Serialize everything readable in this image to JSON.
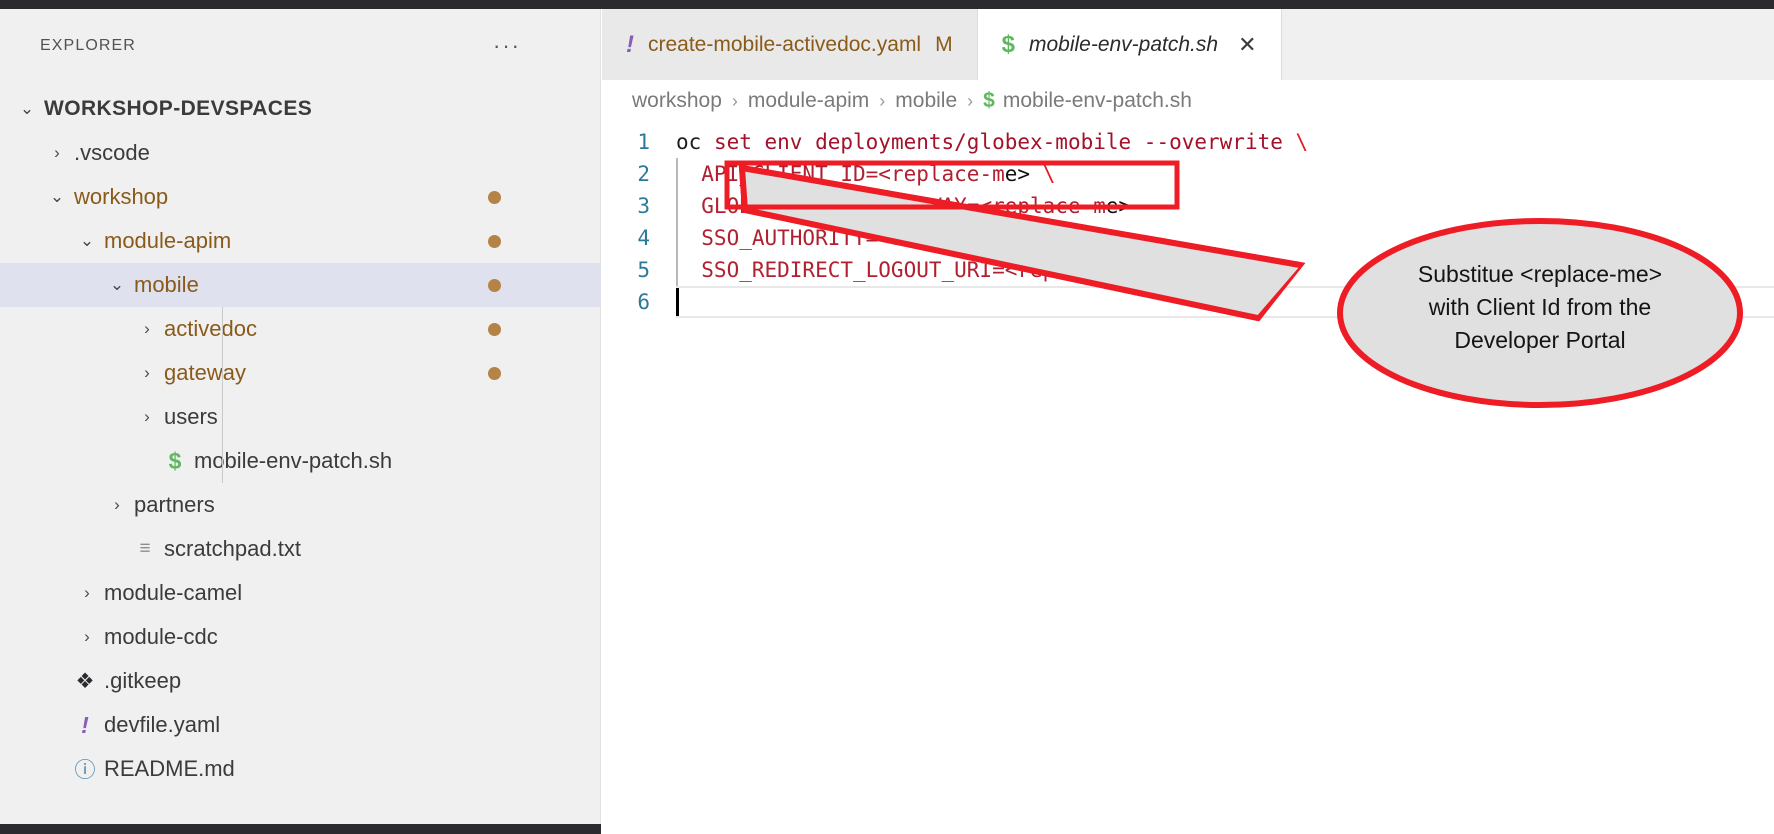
{
  "window": {
    "accent_modified": "#8a5a1b",
    "selection_bg": "#dfe1ef",
    "annotation_color": "#ee1c25",
    "balloon_fill": "#e0e0e0"
  },
  "sidebar": {
    "title": "EXPLORER",
    "more_actions": "···",
    "tree": [
      {
        "label": "WORKSHOP-DEVSPACES",
        "twisty": "⌄",
        "kind": "root",
        "depth": 0,
        "modified": false,
        "selected": false,
        "icon": ""
      },
      {
        "label": ".vscode",
        "twisty": "›",
        "kind": "folder",
        "depth": 1,
        "modified": false,
        "selected": false,
        "icon": ""
      },
      {
        "label": "workshop",
        "twisty": "⌄",
        "kind": "folder-mod",
        "depth": 1,
        "modified": true,
        "selected": false,
        "icon": ""
      },
      {
        "label": "module-apim",
        "twisty": "⌄",
        "kind": "folder-mod",
        "depth": 2,
        "modified": true,
        "selected": false,
        "icon": ""
      },
      {
        "label": "mobile",
        "twisty": "⌄",
        "kind": "folder-mod",
        "depth": 3,
        "modified": true,
        "selected": true,
        "icon": ""
      },
      {
        "label": "activedoc",
        "twisty": "›",
        "kind": "folder-mod",
        "depth": 4,
        "modified": true,
        "selected": false,
        "icon": ""
      },
      {
        "label": "gateway",
        "twisty": "›",
        "kind": "folder-mod",
        "depth": 4,
        "modified": true,
        "selected": false,
        "icon": ""
      },
      {
        "label": "users",
        "twisty": "›",
        "kind": "folder",
        "depth": 4,
        "modified": false,
        "selected": false,
        "icon": ""
      },
      {
        "label": "mobile-env-patch.sh",
        "twisty": "",
        "kind": "file",
        "depth": 4,
        "modified": false,
        "selected": false,
        "icon": "sh-file-icon"
      },
      {
        "label": "partners",
        "twisty": "›",
        "kind": "folder",
        "depth": 3,
        "modified": false,
        "selected": false,
        "icon": ""
      },
      {
        "label": "scratchpad.txt",
        "twisty": "",
        "kind": "file",
        "depth": 3,
        "modified": false,
        "selected": false,
        "icon": "txt-file-icon"
      },
      {
        "label": "module-camel",
        "twisty": "›",
        "kind": "folder",
        "depth": 2,
        "modified": false,
        "selected": false,
        "icon": ""
      },
      {
        "label": "module-cdc",
        "twisty": "›",
        "kind": "folder",
        "depth": 2,
        "modified": false,
        "selected": false,
        "icon": ""
      },
      {
        "label": ".gitkeep",
        "twisty": "",
        "kind": "file",
        "depth": 1,
        "modified": false,
        "selected": false,
        "icon": "git-file-icon"
      },
      {
        "label": "devfile.yaml",
        "twisty": "",
        "kind": "file",
        "depth": 1,
        "modified": false,
        "selected": false,
        "icon": "yaml-file-icon"
      },
      {
        "label": "README.md",
        "twisty": "",
        "kind": "file",
        "depth": 1,
        "modified": false,
        "selected": false,
        "icon": "md-file-icon"
      }
    ]
  },
  "tabs": [
    {
      "label": "create-mobile-activedoc.yaml",
      "icon": "yaml-file-icon",
      "icon_glyph": "!",
      "badge": "M",
      "active": false,
      "preview": false,
      "closable": false
    },
    {
      "label": "mobile-env-patch.sh",
      "icon": "sh-file-icon",
      "icon_glyph": "$",
      "badge": "",
      "active": true,
      "preview": true,
      "closable": true,
      "close_glyph": "✕"
    }
  ],
  "breadcrumb": {
    "items": [
      "workshop",
      "module-apim",
      "mobile",
      "mobile-env-patch.sh"
    ],
    "separator": "›",
    "file_icon_glyph": "$"
  },
  "code": {
    "lines": [
      {
        "no": "1",
        "indent_guide": false,
        "segments": [
          {
            "text": "oc",
            "tok": "tok-cmd"
          },
          {
            "text": " set env deployments/globex-mobile --overwrite ",
            "tok": "tok-str"
          },
          {
            "text": "\\",
            "tok": "tok-esc"
          }
        ]
      },
      {
        "no": "2",
        "indent_guide": true,
        "segments": [
          {
            "text": "  API_CLIENT_ID=",
            "tok": "tok-var"
          },
          {
            "text": "<replace-m",
            "tok": "tok-var"
          },
          {
            "text": "e>",
            "tok": "tok-op"
          },
          {
            "text": " ",
            "tok": "tok-str"
          },
          {
            "text": "\\",
            "tok": "tok-esc"
          }
        ]
      },
      {
        "no": "3",
        "indent_guide": true,
        "segments": [
          {
            "text": "  GLOBEX_MOBILE_GATEWAY=",
            "tok": "tok-var"
          },
          {
            "text": "<replace-m",
            "tok": "tok-var"
          },
          {
            "text": "e>",
            "tok": "tok-op"
          }
        ]
      },
      {
        "no": "4",
        "indent_guide": true,
        "segments": [
          {
            "text": "  SSO_AUTHORITY=",
            "tok": "tok-var"
          },
          {
            "text": "<replace-m",
            "tok": "tok-var"
          },
          {
            "text": "e>",
            "tok": "tok-op"
          },
          {
            "text": " ",
            "tok": "tok-str"
          },
          {
            "text": "\\",
            "tok": "tok-esc"
          }
        ]
      },
      {
        "no": "5",
        "indent_guide": true,
        "segments": [
          {
            "text": "  SSO_REDIRECT_LOGOUT_URI=",
            "tok": "tok-var"
          },
          {
            "text": "<replace-m",
            "tok": "tok-var"
          },
          {
            "text": "e>",
            "tok": "tok-op"
          }
        ]
      },
      {
        "no": "6",
        "indent_guide": false,
        "current": true,
        "segments": []
      }
    ]
  },
  "annotation": {
    "highlight_box_label": "API_CLIENT_ID line highlight",
    "callout_line1": "Substitue <replace-me>",
    "callout_line2": "with Client Id from the",
    "callout_line3": "Developer Portal"
  }
}
